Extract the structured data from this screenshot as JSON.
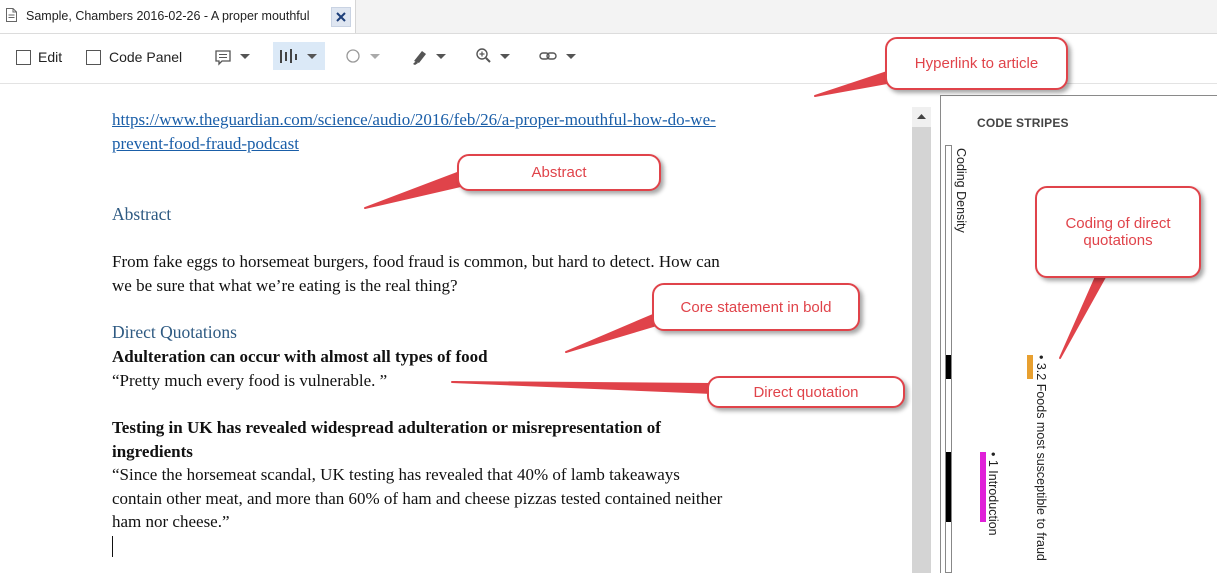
{
  "tab": {
    "title": "Sample, Chambers 2016-02-26 - A proper mouthful"
  },
  "toolbar": {
    "edit_label": "Edit",
    "code_panel_label": "Code Panel"
  },
  "document": {
    "link_line1": "https://www.theguardian.com/science/audio/2016/feb/26/a-proper-mouthful-how-do-we-",
    "link_line2": "prevent-food-fraud-podcast",
    "abstract_heading": "Abstract",
    "abstract_line1": "From fake eggs to horsemeat burgers, food fraud is common, but hard to detect. How can",
    "abstract_line2": "we be sure that what we’re eating is the real thing?",
    "quotations_heading": "Direct Quotations",
    "q1_bold": "Adulteration can occur with almost all types of food",
    "q1_text": "“Pretty much every food is vulnerable. ”",
    "q2_bold_line1": "Testing in UK has revealed widespread adulteration or misrepresentation of",
    "q2_bold_line2": "ingredients",
    "q2_line1": "“Since the horsemeat scandal, UK testing has revealed that 40% of lamb takeaways",
    "q2_line2": "contain other meat, and more than 60% of ham and cheese pizzas tested contained neither",
    "q2_line3": "ham nor cheese.”"
  },
  "side_panel": {
    "title": "CODE STRIPES",
    "density_label": "Coding Density",
    "stripe_intro_label": "• 1 Introduction",
    "stripe_fraud_label": "• 3.2 Foods most susceptible to fraud",
    "intro_color": "#e020d8",
    "fraud_color": "#e8a030"
  },
  "annotations": {
    "hyperlink": "Hyperlink to article",
    "abstract": "Abstract",
    "coding": "Coding of direct quotations",
    "core": "Core statement in bold",
    "quotation": "Direct quotation"
  },
  "icons": [
    "document-icon",
    "close-icon",
    "comment-icon",
    "code-stripes-icon",
    "circle-icon",
    "highlighter-icon",
    "zoom-icon",
    "link-icon"
  ],
  "colors": {
    "accent": "#e0434a",
    "link": "#1a5ea8",
    "heading": "#2e5a82"
  }
}
